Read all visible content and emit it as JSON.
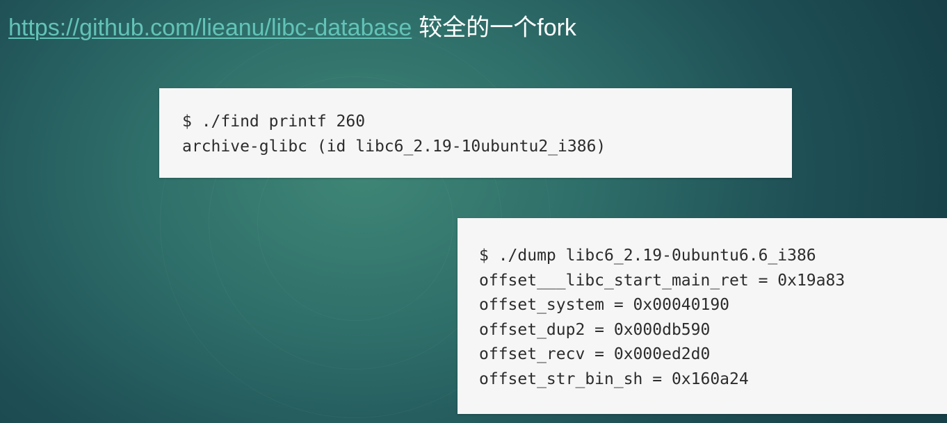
{
  "header": {
    "link_text": "https://github.com/lieanu/libc-database",
    "suffix": "较全的一个fork"
  },
  "find_box": {
    "lines": [
      "$ ./find printf 260",
      "archive-glibc (id libc6_2.19-10ubuntu2_i386)"
    ]
  },
  "dump_box": {
    "lines": [
      "$ ./dump libc6_2.19-0ubuntu6.6_i386",
      "offset___libc_start_main_ret = 0x19a83",
      "offset_system = 0x00040190",
      "offset_dup2 = 0x000db590",
      "offset_recv = 0x000ed2d0",
      "offset_str_bin_sh = 0x160a24"
    ]
  },
  "colors": {
    "link": "#63c3b7",
    "background": "#2f6f6a",
    "code_background": "#f6f6f6",
    "code_text": "#2c2c2c"
  }
}
